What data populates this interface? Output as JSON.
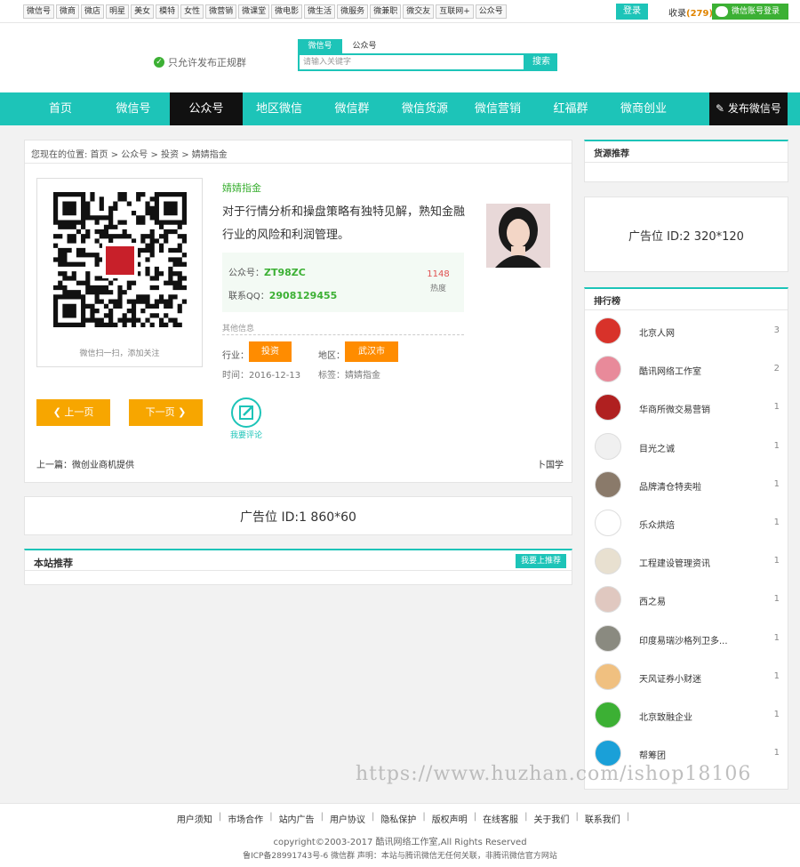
{
  "topbar": {
    "links": [
      "微信号",
      "微商",
      "微店",
      "明星",
      "美女",
      "模特",
      "女性",
      "微营销",
      "微课堂",
      "微电影",
      "微生活",
      "微服务",
      "微兼职",
      "微交友",
      "互联网+",
      "公众号"
    ],
    "login": "登录",
    "fav_prefix": "收录",
    "fav_count": "(279)",
    "wx_login": "微信账号登录"
  },
  "header": {
    "notice": "只允许发布正规群",
    "search_tabs": [
      "微信号",
      "公众号"
    ],
    "search_placeholder": "请输入关键字",
    "search_button": "搜索"
  },
  "nav": {
    "items": [
      "首页",
      "微信号",
      "公众号",
      "地区微信",
      "微信群",
      "微信货源",
      "微信营销",
      "红福群",
      "微商创业"
    ],
    "active": "公众号",
    "publish": "发布微信号"
  },
  "main": {
    "breadcrumb": "您现在的位置: 首页 > 公众号 > 投资 > 婧婧指金",
    "qr_caption": "微信扫一扫，添加关注",
    "account_name": "婧婧指金",
    "description": "对于行情分析和操盘策略有独特见解，熟知金融行业的风险和利润管理。",
    "id_label": "公众号：",
    "id_value": "ZT98ZC",
    "qq_label": "联系QQ：",
    "qq_value": "2908129455",
    "hot_value": "1148",
    "hot_label": "热度",
    "other_info": "其他信息",
    "industry_label": "行业：",
    "industry_value": "投资",
    "region_label": "地区：",
    "region_value": "武汉市",
    "time": "时间：2016-12-13",
    "tags": "标签：婧婧指金",
    "prev_button": "上一页",
    "next_button": "下一页",
    "comment_label": "我要评论",
    "prev_article": "上一篇：微创业商机提供",
    "next_article": "卜国学"
  },
  "ad1": "广告位 ID:1 860*60",
  "recommend": {
    "title": "本站推荐",
    "button": "我要上推荐"
  },
  "sidebar": {
    "source_title": "货源推荐",
    "ad2": "广告位 ID:2 320*120",
    "rank_title": "排行榜",
    "rank": [
      {
        "name": "北京人网",
        "count": "3",
        "color": "#d8322a"
      },
      {
        "name": "酷讯网络工作室",
        "count": "2",
        "color": "#e88a9a"
      },
      {
        "name": "华商所微交易营销",
        "count": "1",
        "color": "#b02020"
      },
      {
        "name": "目光之诚",
        "count": "1",
        "color": "#f0f0f0"
      },
      {
        "name": "品牌清仓特卖啦",
        "count": "1",
        "color": "#8a7a6a"
      },
      {
        "name": "乐众烘焙",
        "count": "1",
        "color": "#ffffff"
      },
      {
        "name": "工程建设管理资讯",
        "count": "1",
        "color": "#e8e0d0"
      },
      {
        "name": "西之易",
        "count": "1",
        "color": "#e0c8c0"
      },
      {
        "name": "印度易瑞沙格列卫多...",
        "count": "1",
        "color": "#8a8a80"
      },
      {
        "name": "天风证券小财迷",
        "count": "1",
        "color": "#f0c080"
      },
      {
        "name": "北京致融企业",
        "count": "1",
        "color": "#3cb034"
      },
      {
        "name": "帮筹团",
        "count": "1",
        "color": "#1aa0d8"
      }
    ]
  },
  "watermark": "https://www.huzhan.com/ishop18106",
  "footer": {
    "links": [
      "用户须知",
      "市场合作",
      "站内广告",
      "用户协议",
      "隐私保护",
      "版权声明",
      "在线客服",
      "关于我们",
      "联系我们"
    ],
    "copyright": "copyright©2003-2017 酷讯网络工作室,All Rights Reserved",
    "icp": "鲁ICP备28991743号-6 微信群   声明：本站与腾讯微信无任何关联，非腾讯微信官方网站"
  }
}
